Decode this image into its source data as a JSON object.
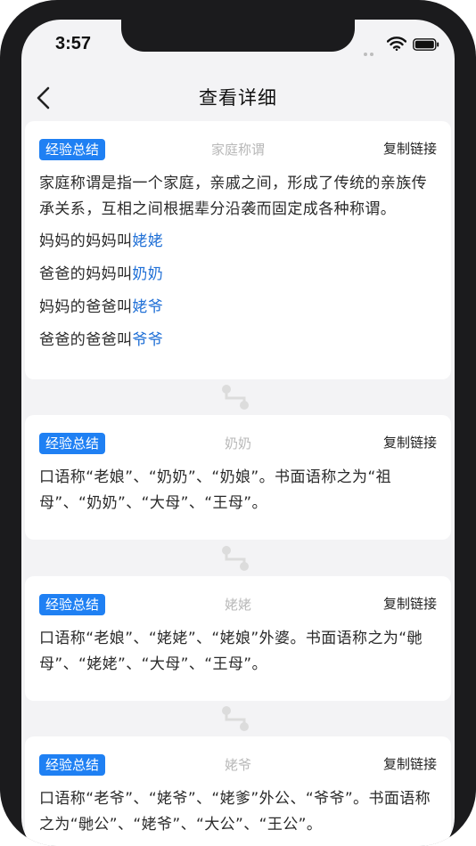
{
  "status_bar": {
    "time": "3:57"
  },
  "nav": {
    "title": "查看详细"
  },
  "cards": [
    {
      "tag": "经验总结",
      "title": "家庭称谓",
      "copy_label": "复制链接",
      "description": "家庭称谓是指一个家庭，亲戚之间，形成了传统的亲族传承关系，互相之间根据辈分沿袭而固定成各种称谓。",
      "lines": [
        {
          "prefix": "妈妈的妈妈叫",
          "term": "姥姥"
        },
        {
          "prefix": "爸爸的妈妈叫",
          "term": "奶奶"
        },
        {
          "prefix": "妈妈的爸爸叫",
          "term": "姥爷"
        },
        {
          "prefix": "爸爸的爸爸叫",
          "term": "爷爷"
        }
      ]
    },
    {
      "tag": "经验总结",
      "title": "奶奶",
      "copy_label": "复制链接",
      "description": "口语称“老娘”、“奶奶”、“奶娘”。书面语称之为“祖母”、“奶奶”、“大母”、“王母”。"
    },
    {
      "tag": "经验总结",
      "title": "姥姥",
      "copy_label": "复制链接",
      "description": "口语称“老娘”、“姥姥”、“姥娘”外婆。书面语称之为“毑母”、“姥姥”、“大母”、“王母”。"
    },
    {
      "tag": "经验总结",
      "title": "姥爷",
      "copy_label": "复制链接",
      "description": "口语称“老爷”、“姥爷”、“姥爹”外公、“爷爷”。书面语称之为“毑公”、“姥爷”、“大公”、“王公”。"
    }
  ],
  "colors": {
    "accent": "#1f80f3",
    "link": "#1f6fd6",
    "background": "#f3f3f5"
  },
  "icons": {
    "back": "chevron-left-icon",
    "connector": "node-link-icon",
    "wifi": "wifi-icon",
    "battery": "battery-icon"
  }
}
